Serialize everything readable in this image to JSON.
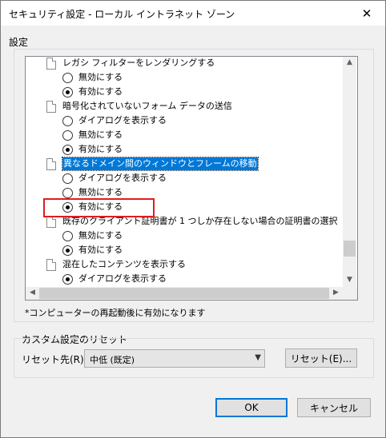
{
  "window": {
    "title": "セキュリティ設定 - ローカル イントラネット ゾーン",
    "close_glyph": "✕"
  },
  "settings": {
    "group_label": "設定",
    "items": [
      {
        "kind": "header",
        "text": "レガシ フィルターをレンダリングする"
      },
      {
        "kind": "option",
        "text": "無効にする",
        "checked": false
      },
      {
        "kind": "option",
        "text": "有効にする",
        "checked": true
      },
      {
        "kind": "header",
        "text": "暗号化されていないフォーム データの送信"
      },
      {
        "kind": "option",
        "text": "ダイアログを表示する",
        "checked": false
      },
      {
        "kind": "option",
        "text": "無効にする",
        "checked": false
      },
      {
        "kind": "option",
        "text": "有効にする",
        "checked": true
      },
      {
        "kind": "header",
        "text": "異なるドメイン間のウィンドウとフレームの移動",
        "selected": true
      },
      {
        "kind": "option",
        "text": "ダイアログを表示する",
        "checked": false
      },
      {
        "kind": "option",
        "text": "無効にする",
        "checked": false
      },
      {
        "kind": "option",
        "text": "有効にする",
        "checked": true
      },
      {
        "kind": "header",
        "text": "既存のクライアント証明書が 1 つしか存在しない場合の証明書の選択"
      },
      {
        "kind": "option",
        "text": "無効にする",
        "checked": false
      },
      {
        "kind": "option",
        "text": "有効にする",
        "checked": true
      },
      {
        "kind": "header",
        "text": "混在したコンテンツを表示する"
      },
      {
        "kind": "option",
        "text": "ダイアログを表示する",
        "checked": true
      }
    ],
    "note": "*コンピューターの再起動後に有効になります"
  },
  "reset": {
    "group_label": "カスタム設定のリセット",
    "target_label": "リセット先(R):",
    "target_value": "中低 (既定)",
    "reset_button": "リセット(E)..."
  },
  "buttons": {
    "ok": "OK",
    "cancel": "キャンセル"
  },
  "colors": {
    "highlight_box": "#e31c1c",
    "selection": "#0078d7"
  }
}
